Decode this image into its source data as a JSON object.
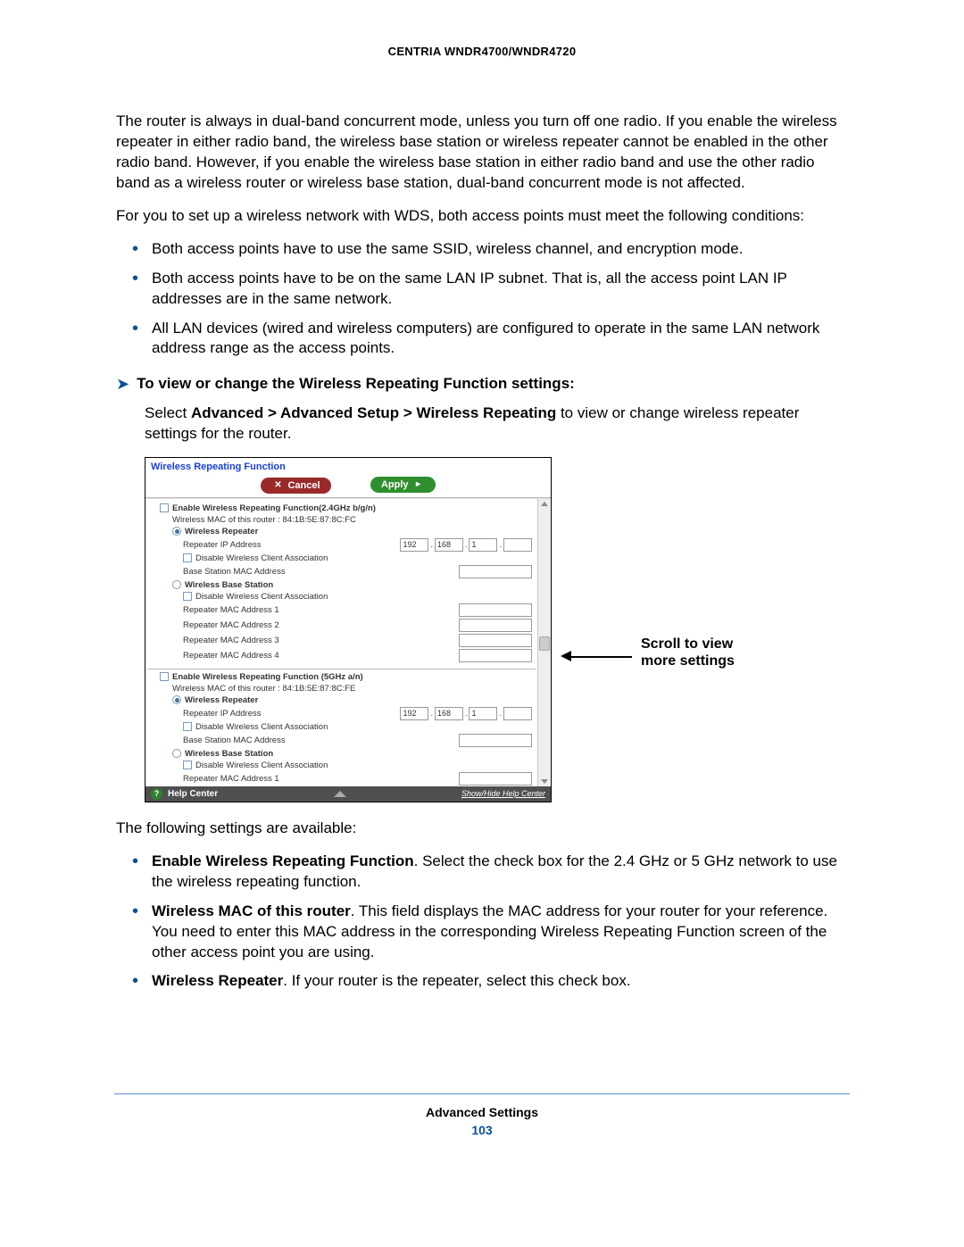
{
  "header": {
    "title": "CENTRIA WNDR4700/WNDR4720"
  },
  "para1": "The router is always in dual-band concurrent mode, unless you turn off one radio. If you enable the wireless repeater in either radio band, the wireless base station or wireless repeater cannot be enabled in the other radio band. However, if you enable the wireless base station in either radio band and use the other radio band as a wireless router or wireless base station, dual-band concurrent mode is not affected.",
  "para2": "For you to set up a wireless network with WDS, both access points must meet the following conditions:",
  "conditions": [
    "Both access points have to use the same SSID, wireless channel, and encryption mode.",
    "Both access points have to be on the same LAN IP subnet. That is, all the access point LAN IP addresses are in the same network.",
    "All LAN devices (wired and wireless computers) are configured to operate in the same LAN network address range as the access points."
  ],
  "proc_title": "To view or change the Wireless Repeating Function settings:",
  "proc_step_pre": "Select ",
  "proc_step_bold": "Advanced > Advanced Setup > Wireless Repeating",
  "proc_step_post": " to view or change wireless repeater settings for the router.",
  "screenshot": {
    "title": "Wireless Repeating Function",
    "buttons": {
      "cancel": "Cancel",
      "apply": "Apply"
    },
    "section24": {
      "enable": "Enable Wireless Repeating Function(2.4GHz b/g/n)",
      "mac_label": "Wireless MAC of this router : 84:1B:5E:87:8C:FC",
      "repeater": "Wireless Repeater",
      "repeater_ip": "Repeater IP Address",
      "ip": {
        "a": "192",
        "b": "168",
        "c": "1"
      },
      "disable_assoc": "Disable Wireless Client Association",
      "base_mac": "Base Station MAC Address",
      "base": "Wireless Base Station",
      "disable_assoc2": "Disable Wireless Client Association",
      "rmac1": "Repeater MAC Address 1",
      "rmac2": "Repeater MAC Address 2",
      "rmac3": "Repeater MAC Address 3",
      "rmac4": "Repeater MAC Address 4"
    },
    "section5": {
      "enable": "Enable Wireless Repeating Function (5GHz a/n)",
      "mac_label": "Wireless MAC of this router : 84:1B:5E:87:8C:FE",
      "repeater": "Wireless Repeater",
      "repeater_ip": "Repeater IP Address",
      "ip": {
        "a": "192",
        "b": "168",
        "c": "1"
      },
      "disable_assoc": "Disable Wireless Client Association",
      "base_mac": "Base Station MAC Address",
      "base": "Wireless Base Station",
      "disable_assoc2": "Disable Wireless Client Association",
      "rmac1": "Repeater MAC Address 1"
    },
    "help": {
      "label": "Help Center",
      "link": "Show/Hide Help Center"
    }
  },
  "callout": "Scroll to view more settings",
  "para3": "The following settings are available:",
  "settings": [
    {
      "b": "Enable Wireless Repeating Function",
      "t": ". Select the check box for the 2.4 GHz or 5 GHz network to use the wireless repeating function."
    },
    {
      "b": "Wireless MAC of this router",
      "t": ". This field displays the MAC address for your router for your reference. You need to enter this MAC address in the corresponding Wireless Repeating Function screen of the other access point you are using."
    },
    {
      "b": "Wireless Repeater",
      "t": ". If your router is the repeater, select this check box."
    }
  ],
  "footer": {
    "title": "Advanced Settings",
    "page": "103"
  }
}
